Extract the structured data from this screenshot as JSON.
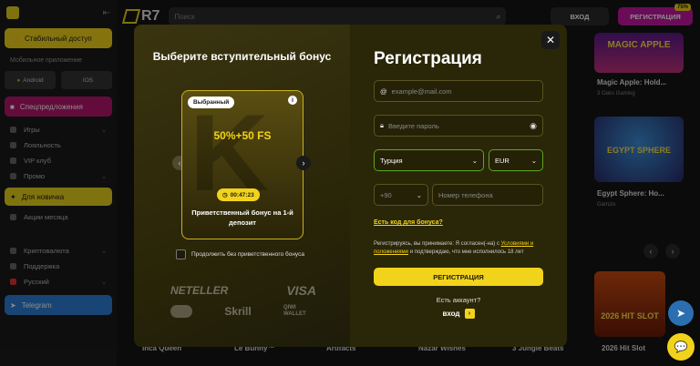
{
  "header": {
    "brand": "R7",
    "search_placeholder": "Поиск",
    "login_label": "ВХОД",
    "register_label": "РЕГИСТРАЦИЯ",
    "register_badge": "75%"
  },
  "sidebar": {
    "stable_access": "Стабильный доступ",
    "mobile_app": "Мобильное приложение",
    "android": "Android",
    "ios": "IOS",
    "items": [
      {
        "label": "Спецпредложения"
      },
      {
        "label": "Игры"
      },
      {
        "label": "Лояльность"
      },
      {
        "label": "VIP клуб"
      },
      {
        "label": "Промо"
      },
      {
        "label": "Для новичка"
      },
      {
        "label": "Акции месяца"
      },
      {
        "label": "Криптовалюта"
      },
      {
        "label": "Поддержка"
      },
      {
        "label": "Русский"
      },
      {
        "label": "Telegram"
      }
    ]
  },
  "background": {
    "games_right": [
      {
        "title": "Magic Apple: Hold...",
        "provider": "3 Oaks Gaming",
        "art": "MAGIC APPLE"
      },
      {
        "title": "Egypt Sphere: Ho...",
        "provider": "Gamzix",
        "art": "EGYPT SPHERE"
      },
      {
        "title": "",
        "provider": "",
        "art": "2026 HIT SLOT"
      }
    ],
    "bottom_titles": [
      "Inca Queen",
      "Le Bunny™",
      "Artifacts",
      "Nazar Wishes",
      "3 Jungle Beats",
      "2026 Hit Slot"
    ]
  },
  "bonus_panel": {
    "title": "Выберите вступительный бонус",
    "selected_pill": "Выбранный",
    "offer": "50%+50 FS",
    "timer": "00:47:23",
    "description": "Приветственный бонус на 1-й депозит",
    "no_bonus_label": "Продолжить без приветственного бонуса",
    "payments": [
      "NETELLER",
      "VISA",
      "Skrill",
      "QIWI WALLET"
    ]
  },
  "registration": {
    "title": "Регистрация",
    "email_placeholder": "example@mail.com",
    "password_placeholder": "Введите пароль",
    "country": "Турция",
    "currency": "EUR",
    "phone_code": "+90",
    "phone_placeholder": "Номер телефона",
    "promo_link": "Есть код для бонуса?",
    "terms_prefix": "Регистрируясь, вы принимаете: Я согласен(-на) с ",
    "terms_link": "Условиями и положениями",
    "terms_suffix": " и подтверждаю, что мне исполнилось 18 лет",
    "submit_label": "РЕГИСТРАЦИЯ",
    "has_account": "Есть аккаунт?",
    "login_label": "вход"
  }
}
